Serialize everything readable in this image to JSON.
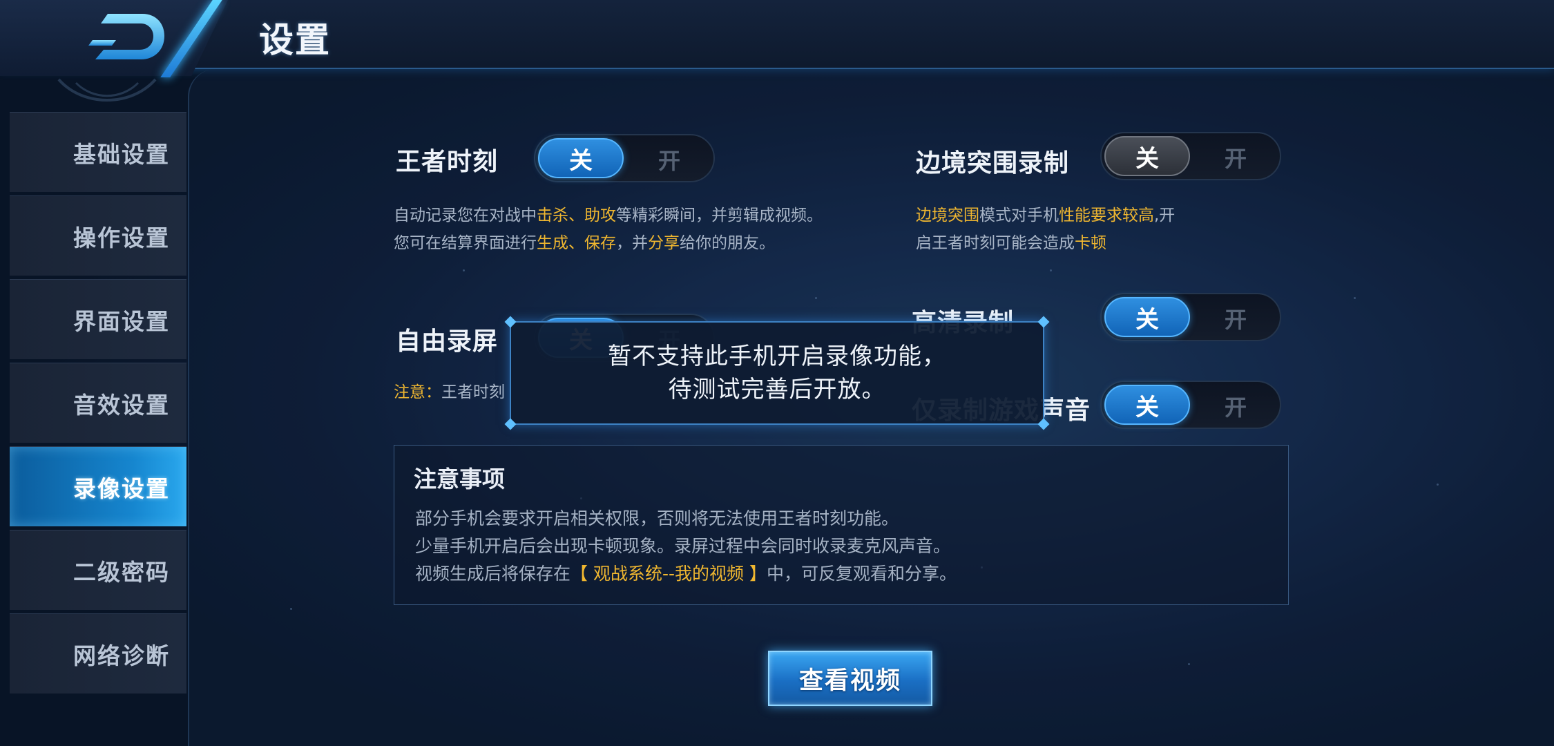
{
  "header": {
    "title": "设置"
  },
  "sidebar": {
    "items": [
      {
        "label": "基础设置",
        "active": false
      },
      {
        "label": "操作设置",
        "active": false
      },
      {
        "label": "界面设置",
        "active": false
      },
      {
        "label": "音效设置",
        "active": false
      },
      {
        "label": "录像设置",
        "active": true
      },
      {
        "label": "二级密码",
        "active": false
      },
      {
        "label": "网络诊断",
        "active": false
      }
    ]
  },
  "settings": {
    "king_moment": {
      "label": "王者时刻",
      "off": "关",
      "on": "开",
      "state": "off",
      "desc1_a": "自动记录您在对战中",
      "desc1_b": "击杀",
      "desc1_c": "、",
      "desc1_d": "助攻",
      "desc1_e": "等精彩瞬间，并剪辑成视频。",
      "desc2_a": "您可在结算界面进行",
      "desc2_b": "生成",
      "desc2_c": "、",
      "desc2_d": "保存",
      "desc2_e": "，并",
      "desc2_f": "分享",
      "desc2_g": "给你的朋友。"
    },
    "border_breakout": {
      "label": "边境突围录制",
      "off": "关",
      "on": "开",
      "state": "off",
      "desc1_a": "边境突围",
      "desc1_b": "模式对手机",
      "desc1_c": "性能要求较高",
      "desc1_d": ",开",
      "desc2_a": "启王者时刻可能会造成",
      "desc2_b": "卡顿"
    },
    "free_record": {
      "label": "自由录屏",
      "off": "关",
      "on": "开",
      "state": "off",
      "note_a": "注意：",
      "note_b": "王者时刻"
    },
    "hd_record": {
      "label": "高清录制",
      "off": "关",
      "on": "开",
      "state": "off"
    },
    "game_sound_only": {
      "label": "仅录制游戏声音",
      "off": "关",
      "on": "开",
      "state": "off"
    }
  },
  "notice": {
    "title": "注意事项",
    "line1": "部分手机会要求开启相关权限，否则将无法使用王者时刻功能。",
    "line2": "少量手机开启后会出现卡顿现象。录屏过程中会同时收录麦克风声音。",
    "line3_a": "视频生成后将保存在",
    "line3_b": "【 观战系统--我的视频 】",
    "line3_c": "中，可反复观看和分享。"
  },
  "view_button": {
    "label": "查看视频"
  },
  "toast": {
    "line1": "暂不支持此手机开启录像功能，",
    "line2": "待测试完善后开放。"
  },
  "colors": {
    "accent": "#1686cf",
    "highlight": "#f0b730",
    "knob_active": "#2f8fe0"
  },
  "icons": {
    "back": "back-arrow-icon"
  }
}
